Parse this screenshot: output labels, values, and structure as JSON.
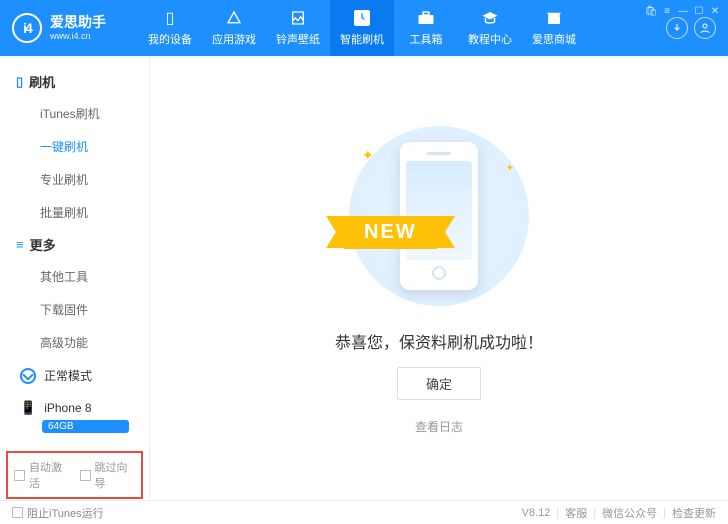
{
  "brand": {
    "title": "爱思助手",
    "sub": "www.i4.cn",
    "logo": "i4"
  },
  "tabs": [
    {
      "label": "我的设备"
    },
    {
      "label": "应用游戏"
    },
    {
      "label": "铃声壁纸"
    },
    {
      "label": "智能刷机"
    },
    {
      "label": "工具箱"
    },
    {
      "label": "教程中心"
    },
    {
      "label": "爱思商城"
    }
  ],
  "sidebar": {
    "g1": {
      "title": "刷机",
      "items": [
        "iTunes刷机",
        "一键刷机",
        "专业刷机",
        "批量刷机"
      ]
    },
    "g2": {
      "title": "更多",
      "items": [
        "其他工具",
        "下载固件",
        "高级功能"
      ]
    },
    "mode": "正常模式",
    "device": {
      "name": "iPhone 8",
      "storage": "64GB"
    },
    "checks": {
      "c1": "自动激活",
      "c2": "跳过向导"
    }
  },
  "main": {
    "ribbon": "NEW",
    "message": "恭喜您，保资料刷机成功啦！",
    "confirm": "确定",
    "logLink": "查看日志"
  },
  "footer": {
    "block": "阻止iTunes运行",
    "version": "V8.12",
    "support": "客服",
    "wechat": "微信公众号",
    "update": "检查更新"
  }
}
